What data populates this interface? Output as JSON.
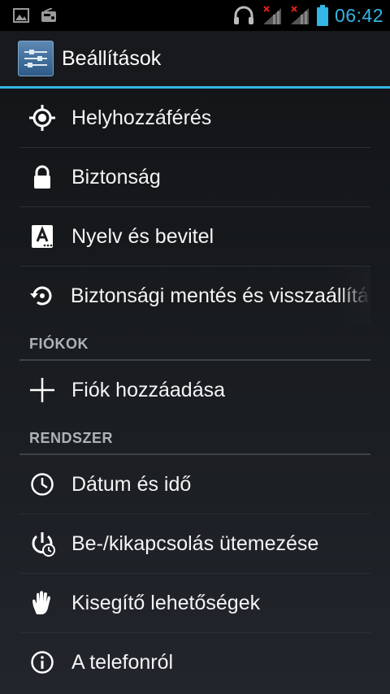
{
  "status": {
    "time": "06:42"
  },
  "app": {
    "title": "Beállítások"
  },
  "items_top": [
    {
      "label": "Helyhozzáférés",
      "icon": "location-icon"
    },
    {
      "label": "Biztonság",
      "icon": "lock-icon"
    },
    {
      "label": "Nyelv és bevitel",
      "icon": "language-icon"
    },
    {
      "label": "Biztonsági mentés és visszaállítás",
      "icon": "backup-icon"
    }
  ],
  "sections": {
    "accounts": "FIÓKOK",
    "system": "RENDSZER"
  },
  "accounts": {
    "add_label": "Fiók hozzáadása"
  },
  "system_items": [
    {
      "label": "Dátum és idő",
      "icon": "clock-icon"
    },
    {
      "label": "Be-/kikapcsolás ütemezése",
      "icon": "power-schedule-icon"
    },
    {
      "label": "Kisegítő lehetőségek",
      "icon": "hand-icon"
    },
    {
      "label": "A telefonról",
      "icon": "info-icon"
    }
  ],
  "colors": {
    "accent": "#33b5e5"
  }
}
